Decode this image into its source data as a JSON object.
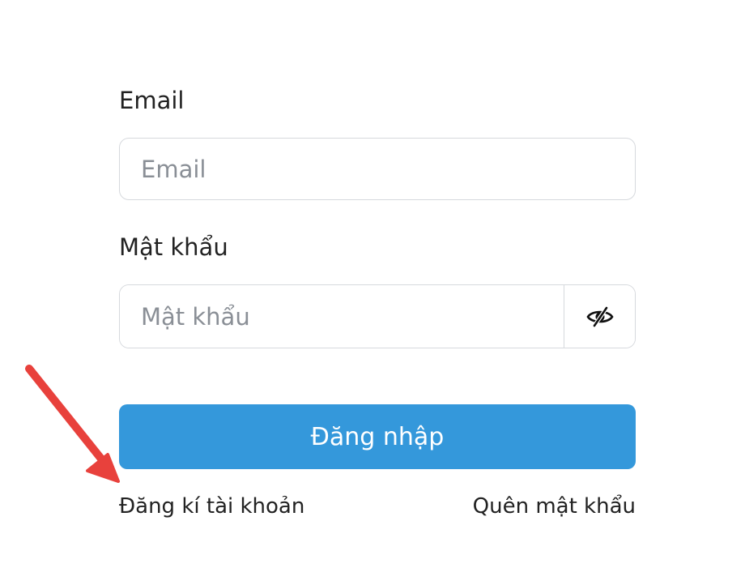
{
  "form": {
    "email_label": "Email",
    "email_placeholder": "Email",
    "email_value": "",
    "password_label": "Mật khẩu",
    "password_placeholder": "Mật khẩu",
    "password_value": "",
    "login_label": "Đăng nhập",
    "register_label": "Đăng kí tài khoản",
    "forgot_label": "Quên mật khẩu"
  },
  "icons": {
    "password_toggle": "eye-slash-icon",
    "annotation": "red-arrow"
  },
  "colors": {
    "primary": "#3498db",
    "arrow": "#e8413c",
    "text": "#222222",
    "border": "#d6d9dd"
  }
}
